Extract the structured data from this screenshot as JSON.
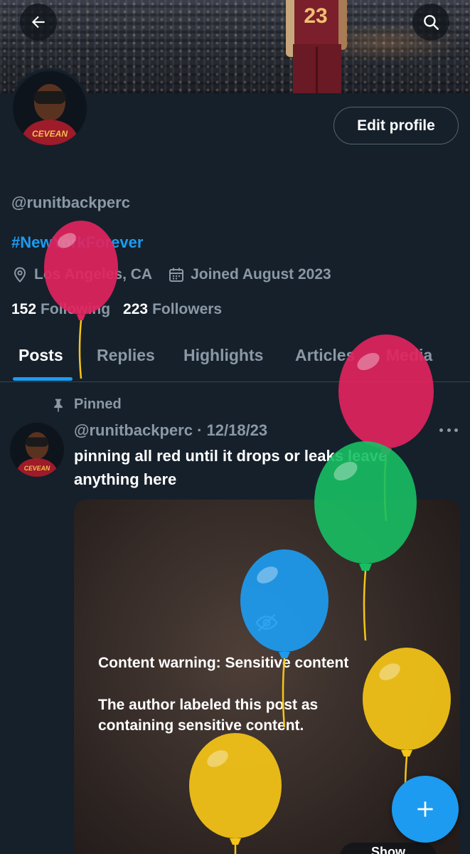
{
  "header": {
    "back_icon": "arrow-left-icon",
    "search_icon": "search-icon",
    "banner_jersey_number": "23"
  },
  "profile": {
    "edit_label": "Edit profile",
    "handle": "@runitbackperc",
    "bio_hashtag": "#NewYorkForever",
    "location": "Los Angeles, CA",
    "joined": "Joined August 2023",
    "following_count": "152",
    "following_label": "Following",
    "followers_count": "223",
    "followers_label": "Followers",
    "avatar_jersey_text": "CEVEAN"
  },
  "tabs": [
    {
      "label": "Posts",
      "active": true
    },
    {
      "label": "Replies"
    },
    {
      "label": "Highlights"
    },
    {
      "label": "Articles"
    },
    {
      "label": "Media"
    }
  ],
  "post": {
    "pinned_label": "Pinned",
    "author": "@runitbackperc",
    "separator": " · ",
    "date": "12/18/23",
    "text": "pinning all red until it drops or leaks leave anything here",
    "warning_title": "Content warning: Sensitive content",
    "warning_text": "The author labeled this post as containing sensitive content.",
    "show_label": "Show"
  },
  "colors": {
    "background": "#15202b",
    "accent": "#1d9bf0",
    "secondary_text": "#8b98a5",
    "balloon_red": "#e0245e",
    "balloon_green": "#17bf63",
    "balloon_blue": "#1d9bf0",
    "balloon_yellow": "#f5c518"
  },
  "fab_icon": "plus-icon"
}
